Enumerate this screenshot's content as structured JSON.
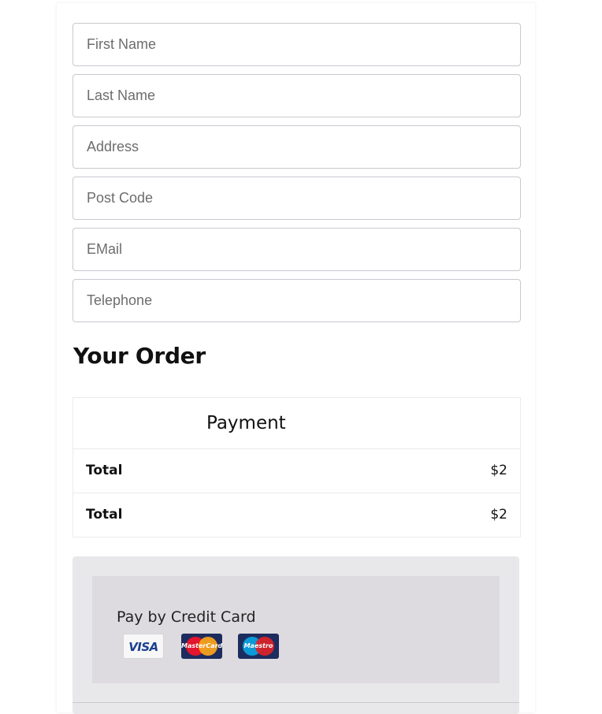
{
  "form": {
    "first_name_placeholder": "First Name",
    "last_name_placeholder": "Last Name",
    "address_placeholder": "Address",
    "post_code_placeholder": "Post Code",
    "email_placeholder": "EMail",
    "telephone_placeholder": "Telephone"
  },
  "order": {
    "title": "Your Order",
    "table_header": "Payment",
    "rows": [
      {
        "label": "Total",
        "value": "$2"
      },
      {
        "label": "Total",
        "value": "$2"
      }
    ]
  },
  "payment": {
    "method_label": "Pay by Credit Card",
    "cards": [
      {
        "name": "VISA",
        "icon": "visa-logo"
      },
      {
        "name": "MasterCard",
        "icon": "mastercard-logo"
      },
      {
        "name": "Maestro",
        "icon": "maestro-logo"
      }
    ]
  },
  "colors": {
    "field_border": "#c6c9cf",
    "payment_panel": "#e8e8ea",
    "payment_inner": "#dddbdf",
    "card_navy": "#1d2c5e"
  }
}
